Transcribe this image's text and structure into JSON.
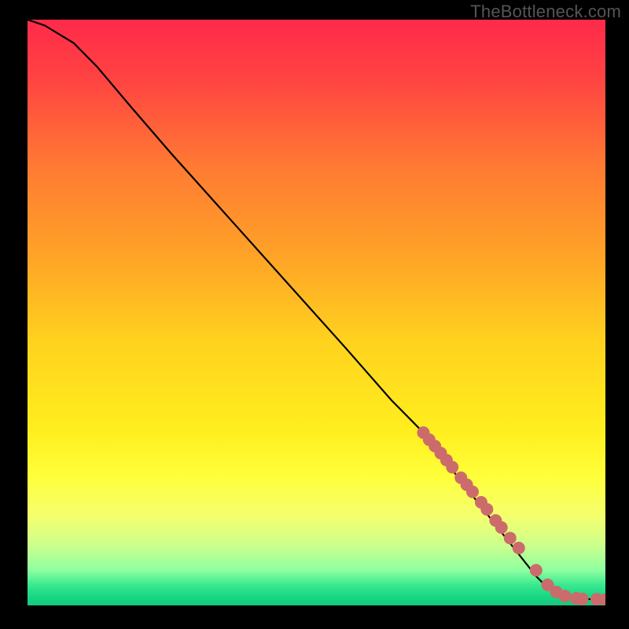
{
  "watermark": "TheBottleneck.com",
  "colors": {
    "outer_bg": "#000000",
    "watermark": "#555555",
    "curve": "#000000",
    "dot_fill": "#cc6b6b",
    "dot_stroke": "#a84f4f",
    "gradient_stops": [
      {
        "offset": 0.0,
        "color": "#ff2a4a"
      },
      {
        "offset": 0.1,
        "color": "#ff4342"
      },
      {
        "offset": 0.25,
        "color": "#ff7a33"
      },
      {
        "offset": 0.4,
        "color": "#ffa227"
      },
      {
        "offset": 0.55,
        "color": "#ffd21e"
      },
      {
        "offset": 0.7,
        "color": "#ffee1e"
      },
      {
        "offset": 0.78,
        "color": "#ffff3a"
      },
      {
        "offset": 0.85,
        "color": "#f4ff70"
      },
      {
        "offset": 0.9,
        "color": "#c9ff8e"
      },
      {
        "offset": 0.94,
        "color": "#8effa0"
      },
      {
        "offset": 0.965,
        "color": "#39e98f"
      },
      {
        "offset": 0.985,
        "color": "#18d684"
      },
      {
        "offset": 1.0,
        "color": "#15c97d"
      }
    ]
  },
  "chart_data": {
    "type": "line",
    "title": "",
    "xlabel": "",
    "ylabel": "",
    "xlim": [
      0,
      100
    ],
    "ylim": [
      0,
      100
    ],
    "series": [
      {
        "name": "bottleneck-curve",
        "x": [
          0,
          3,
          8,
          12,
          18,
          25,
          35,
          45,
          55,
          63,
          68,
          72,
          76,
          80,
          84,
          88,
          90,
          92,
          94,
          96,
          98,
          100
        ],
        "y": [
          100,
          99,
          96,
          92,
          85,
          77,
          66,
          55,
          44,
          35,
          30,
          25,
          20,
          15,
          10,
          5,
          3,
          2,
          1.4,
          1.1,
          1.05,
          1.0
        ]
      }
    ],
    "scatter": [
      {
        "name": "highlighted-points",
        "x": [
          68.5,
          69.5,
          70.5,
          71.5,
          72.5,
          73.5,
          75.0,
          76.0,
          77.0,
          78.5,
          79.5,
          81.0,
          82.0,
          83.5,
          85.0,
          88.0,
          90.0,
          91.5,
          93.0,
          95.0,
          96.0,
          98.5,
          100.0
        ],
        "y": [
          29.5,
          28.3,
          27.2,
          26.0,
          24.8,
          23.6,
          21.8,
          20.6,
          19.4,
          17.6,
          16.4,
          14.5,
          13.3,
          11.5,
          9.8,
          6.0,
          3.5,
          2.3,
          1.6,
          1.2,
          1.1,
          1.05,
          1.0
        ]
      }
    ]
  }
}
